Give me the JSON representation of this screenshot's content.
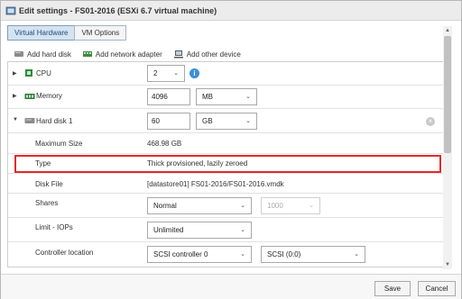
{
  "window": {
    "title": "Edit settings - FS01-2016 (ESXi 6.7 virtual machine)",
    "icon": "vm-edit-icon"
  },
  "tabs": [
    {
      "label": "Virtual Hardware",
      "active": true
    },
    {
      "label": "VM Options",
      "active": false
    }
  ],
  "toolbar": {
    "add_hard_disk": "Add hard disk",
    "add_network_adapter": "Add network adapter",
    "add_other_device": "Add other device"
  },
  "hardware": {
    "cpu": {
      "label": "CPU",
      "value": "2"
    },
    "memory": {
      "label": "Memory",
      "value": "4096",
      "unit": "MB"
    },
    "hard_disk": {
      "label": "Hard disk 1",
      "value": "60",
      "unit": "GB",
      "max_size_label": "Maximum Size",
      "max_size_value": "468.98 GB",
      "type_label": "Type",
      "type_value": "Thick provisioned, lazily zeroed",
      "disk_file_label": "Disk File",
      "disk_file_value": "[datastore01] FS01-2016/FS01-2016.vmdk",
      "shares_label": "Shares",
      "shares_value": "Normal",
      "shares_amount": "1000",
      "limit_label": "Limit - IOPs",
      "limit_value": "Unlimited",
      "controller_label": "Controller location",
      "controller_value": "SCSI controller 0",
      "controller_slot": "SCSI (0:0)"
    }
  },
  "footer": {
    "save_label": "Save",
    "cancel_label": "Cancel"
  },
  "colors": {
    "highlight": "#e12b2b",
    "tab_active": "#d4e3f1",
    "info": "#3d8fd1"
  }
}
